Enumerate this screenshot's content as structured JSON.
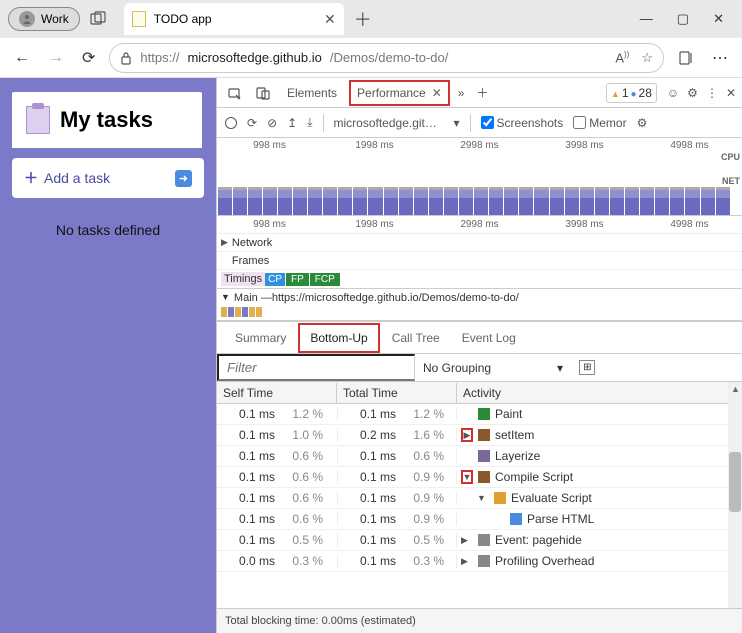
{
  "titlebar": {
    "profile_label": "Work",
    "tab_title": "TODO app"
  },
  "toolbar": {
    "url_prefix": "https://",
    "url_host": "microsoftedge.github.io",
    "url_path": "/Demos/demo-to-do/"
  },
  "app": {
    "heading": "My tasks",
    "add_task": "Add a task",
    "empty": "No tasks defined"
  },
  "devtools": {
    "tabs": {
      "elements": "Elements",
      "performance": "Performance"
    },
    "warnings": "1",
    "info": "28",
    "subbar": {
      "url": "microsoftedge.github.i…",
      "screenshots": "Screenshots",
      "memory": "Memor"
    },
    "ticks_mini": [
      "998 ms",
      "1998 ms",
      "2998 ms",
      "3998 ms",
      "4998 ms"
    ],
    "ticks_main": [
      "998 ms",
      "1998 ms",
      "2998 ms",
      "3998 ms",
      "4998 ms"
    ],
    "cpu_label": "CPU",
    "net_label": "NET",
    "tracks": {
      "network": "Network",
      "frames": "Frames",
      "timings": "Timings",
      "dcl": "CP",
      "fp": "FP",
      "fcp": "FCP",
      "main_prefix": "Main — ",
      "main_url": "https://microsoftedge.github.io/Demos/demo-to-do/"
    },
    "detail_tabs": {
      "summary": "Summary",
      "bottomup": "Bottom-Up",
      "calltree": "Call Tree",
      "eventlog": "Event Log"
    },
    "filter_placeholder": "Filter",
    "grouping": "No Grouping",
    "table": {
      "headers": {
        "self": "Self Time",
        "total": "Total Time",
        "activity": "Activity"
      },
      "rows": [
        {
          "self_ms": "0.1 ms",
          "self_pct": "1.2 %",
          "total_ms": "0.1 ms",
          "total_pct": "1.2 %",
          "expand": "",
          "hl": false,
          "indent": 0,
          "color": "green",
          "name": "Paint"
        },
        {
          "self_ms": "0.1 ms",
          "self_pct": "1.0 %",
          "total_ms": "0.2 ms",
          "total_pct": "1.6 %",
          "expand": "▶",
          "hl": true,
          "indent": 0,
          "color": "brown",
          "name": "setItem"
        },
        {
          "self_ms": "0.1 ms",
          "self_pct": "0.6 %",
          "total_ms": "0.1 ms",
          "total_pct": "0.6 %",
          "expand": "",
          "hl": false,
          "indent": 0,
          "color": "purple",
          "name": "Layerize"
        },
        {
          "self_ms": "0.1 ms",
          "self_pct": "0.6 %",
          "total_ms": "0.1 ms",
          "total_pct": "0.9 %",
          "expand": "▼",
          "hl": true,
          "indent": 0,
          "color": "brown",
          "name": "Compile Script"
        },
        {
          "self_ms": "0.1 ms",
          "self_pct": "0.6 %",
          "total_ms": "0.1 ms",
          "total_pct": "0.9 %",
          "expand": "▼",
          "hl": false,
          "indent": 1,
          "color": "orange",
          "name": "Evaluate Script"
        },
        {
          "self_ms": "0.1 ms",
          "self_pct": "0.6 %",
          "total_ms": "0.1 ms",
          "total_pct": "0.9 %",
          "expand": "",
          "hl": false,
          "indent": 2,
          "color": "blue",
          "name": "Parse HTML"
        },
        {
          "self_ms": "0.1 ms",
          "self_pct": "0.5 %",
          "total_ms": "0.1 ms",
          "total_pct": "0.5 %",
          "expand": "▶",
          "hl": false,
          "indent": 0,
          "color": "gray",
          "name": "Event: pagehide"
        },
        {
          "self_ms": "0.0 ms",
          "self_pct": "0.3 %",
          "total_ms": "0.1 ms",
          "total_pct": "0.3 %",
          "expand": "▶",
          "hl": false,
          "indent": 0,
          "color": "gray",
          "name": "Profiling Overhead"
        }
      ]
    },
    "footer": "Total blocking time: 0.00ms (estimated)"
  }
}
